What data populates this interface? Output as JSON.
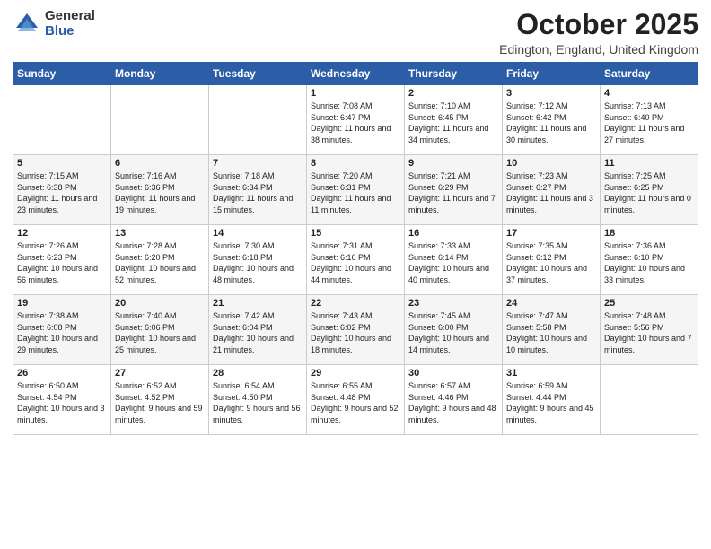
{
  "header": {
    "logo_general": "General",
    "logo_blue": "Blue",
    "title": "October 2025",
    "subtitle": "Edington, England, United Kingdom"
  },
  "weekdays": [
    "Sunday",
    "Monday",
    "Tuesday",
    "Wednesday",
    "Thursday",
    "Friday",
    "Saturday"
  ],
  "weeks": [
    [
      {
        "day": "",
        "sunrise": "",
        "sunset": "",
        "daylight": ""
      },
      {
        "day": "",
        "sunrise": "",
        "sunset": "",
        "daylight": ""
      },
      {
        "day": "",
        "sunrise": "",
        "sunset": "",
        "daylight": ""
      },
      {
        "day": "1",
        "sunrise": "Sunrise: 7:08 AM",
        "sunset": "Sunset: 6:47 PM",
        "daylight": "Daylight: 11 hours and 38 minutes."
      },
      {
        "day": "2",
        "sunrise": "Sunrise: 7:10 AM",
        "sunset": "Sunset: 6:45 PM",
        "daylight": "Daylight: 11 hours and 34 minutes."
      },
      {
        "day": "3",
        "sunrise": "Sunrise: 7:12 AM",
        "sunset": "Sunset: 6:42 PM",
        "daylight": "Daylight: 11 hours and 30 minutes."
      },
      {
        "day": "4",
        "sunrise": "Sunrise: 7:13 AM",
        "sunset": "Sunset: 6:40 PM",
        "daylight": "Daylight: 11 hours and 27 minutes."
      }
    ],
    [
      {
        "day": "5",
        "sunrise": "Sunrise: 7:15 AM",
        "sunset": "Sunset: 6:38 PM",
        "daylight": "Daylight: 11 hours and 23 minutes."
      },
      {
        "day": "6",
        "sunrise": "Sunrise: 7:16 AM",
        "sunset": "Sunset: 6:36 PM",
        "daylight": "Daylight: 11 hours and 19 minutes."
      },
      {
        "day": "7",
        "sunrise": "Sunrise: 7:18 AM",
        "sunset": "Sunset: 6:34 PM",
        "daylight": "Daylight: 11 hours and 15 minutes."
      },
      {
        "day": "8",
        "sunrise": "Sunrise: 7:20 AM",
        "sunset": "Sunset: 6:31 PM",
        "daylight": "Daylight: 11 hours and 11 minutes."
      },
      {
        "day": "9",
        "sunrise": "Sunrise: 7:21 AM",
        "sunset": "Sunset: 6:29 PM",
        "daylight": "Daylight: 11 hours and 7 minutes."
      },
      {
        "day": "10",
        "sunrise": "Sunrise: 7:23 AM",
        "sunset": "Sunset: 6:27 PM",
        "daylight": "Daylight: 11 hours and 3 minutes."
      },
      {
        "day": "11",
        "sunrise": "Sunrise: 7:25 AM",
        "sunset": "Sunset: 6:25 PM",
        "daylight": "Daylight: 11 hours and 0 minutes."
      }
    ],
    [
      {
        "day": "12",
        "sunrise": "Sunrise: 7:26 AM",
        "sunset": "Sunset: 6:23 PM",
        "daylight": "Daylight: 10 hours and 56 minutes."
      },
      {
        "day": "13",
        "sunrise": "Sunrise: 7:28 AM",
        "sunset": "Sunset: 6:20 PM",
        "daylight": "Daylight: 10 hours and 52 minutes."
      },
      {
        "day": "14",
        "sunrise": "Sunrise: 7:30 AM",
        "sunset": "Sunset: 6:18 PM",
        "daylight": "Daylight: 10 hours and 48 minutes."
      },
      {
        "day": "15",
        "sunrise": "Sunrise: 7:31 AM",
        "sunset": "Sunset: 6:16 PM",
        "daylight": "Daylight: 10 hours and 44 minutes."
      },
      {
        "day": "16",
        "sunrise": "Sunrise: 7:33 AM",
        "sunset": "Sunset: 6:14 PM",
        "daylight": "Daylight: 10 hours and 40 minutes."
      },
      {
        "day": "17",
        "sunrise": "Sunrise: 7:35 AM",
        "sunset": "Sunset: 6:12 PM",
        "daylight": "Daylight: 10 hours and 37 minutes."
      },
      {
        "day": "18",
        "sunrise": "Sunrise: 7:36 AM",
        "sunset": "Sunset: 6:10 PM",
        "daylight": "Daylight: 10 hours and 33 minutes."
      }
    ],
    [
      {
        "day": "19",
        "sunrise": "Sunrise: 7:38 AM",
        "sunset": "Sunset: 6:08 PM",
        "daylight": "Daylight: 10 hours and 29 minutes."
      },
      {
        "day": "20",
        "sunrise": "Sunrise: 7:40 AM",
        "sunset": "Sunset: 6:06 PM",
        "daylight": "Daylight: 10 hours and 25 minutes."
      },
      {
        "day": "21",
        "sunrise": "Sunrise: 7:42 AM",
        "sunset": "Sunset: 6:04 PM",
        "daylight": "Daylight: 10 hours and 21 minutes."
      },
      {
        "day": "22",
        "sunrise": "Sunrise: 7:43 AM",
        "sunset": "Sunset: 6:02 PM",
        "daylight": "Daylight: 10 hours and 18 minutes."
      },
      {
        "day": "23",
        "sunrise": "Sunrise: 7:45 AM",
        "sunset": "Sunset: 6:00 PM",
        "daylight": "Daylight: 10 hours and 14 minutes."
      },
      {
        "day": "24",
        "sunrise": "Sunrise: 7:47 AM",
        "sunset": "Sunset: 5:58 PM",
        "daylight": "Daylight: 10 hours and 10 minutes."
      },
      {
        "day": "25",
        "sunrise": "Sunrise: 7:48 AM",
        "sunset": "Sunset: 5:56 PM",
        "daylight": "Daylight: 10 hours and 7 minutes."
      }
    ],
    [
      {
        "day": "26",
        "sunrise": "Sunrise: 6:50 AM",
        "sunset": "Sunset: 4:54 PM",
        "daylight": "Daylight: 10 hours and 3 minutes."
      },
      {
        "day": "27",
        "sunrise": "Sunrise: 6:52 AM",
        "sunset": "Sunset: 4:52 PM",
        "daylight": "Daylight: 9 hours and 59 minutes."
      },
      {
        "day": "28",
        "sunrise": "Sunrise: 6:54 AM",
        "sunset": "Sunset: 4:50 PM",
        "daylight": "Daylight: 9 hours and 56 minutes."
      },
      {
        "day": "29",
        "sunrise": "Sunrise: 6:55 AM",
        "sunset": "Sunset: 4:48 PM",
        "daylight": "Daylight: 9 hours and 52 minutes."
      },
      {
        "day": "30",
        "sunrise": "Sunrise: 6:57 AM",
        "sunset": "Sunset: 4:46 PM",
        "daylight": "Daylight: 9 hours and 48 minutes."
      },
      {
        "day": "31",
        "sunrise": "Sunrise: 6:59 AM",
        "sunset": "Sunset: 4:44 PM",
        "daylight": "Daylight: 9 hours and 45 minutes."
      },
      {
        "day": "",
        "sunrise": "",
        "sunset": "",
        "daylight": ""
      }
    ]
  ]
}
